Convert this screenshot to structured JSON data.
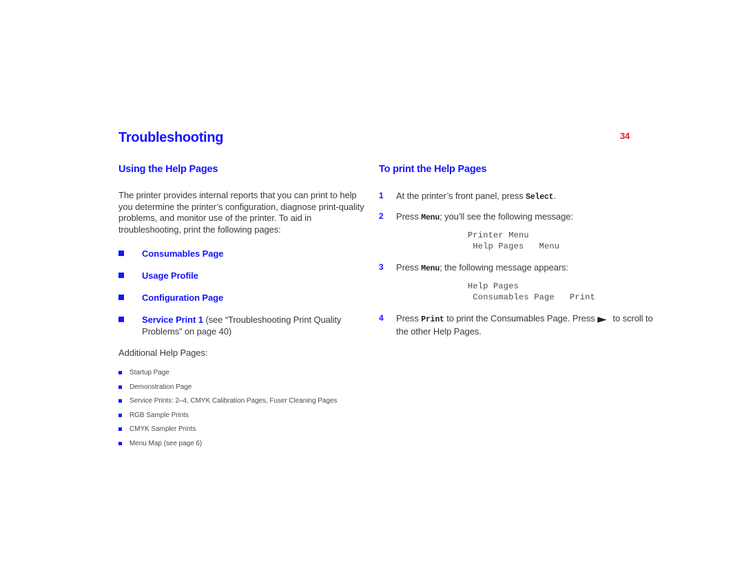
{
  "page": {
    "number": "34",
    "chapter_title": "Troubleshooting",
    "accent_blue": "#1414FF",
    "accent_red": "#ED1C24",
    "body_color": "#3A3A3C"
  },
  "left_column": {
    "heading": "Using the Help Pages",
    "intro_paragraph": "The printer provides internal reports that you can print to help you determine the printer’s configuration, diagnose print-quality problems, and monitor use of the printer.  To aid in troubleshooting, print the following pages:",
    "bullets": [
      {
        "label": "Consumables Page",
        "note": ""
      },
      {
        "label": "Usage Profile",
        "note": ""
      },
      {
        "label": "Configuration Page",
        "note": ""
      },
      {
        "label": "Service Print 1",
        "note": " (see “Troubleshooting Print Quality Problems” on page 40)"
      }
    ],
    "additional_label": "Additional Help Pages:",
    "additional_items": [
      "Startup Page",
      "Demonstration Page",
      "Service Prints: 2–4, CMYK Calibration Pages, Fuser Cleaning Pages",
      "RGB Sample Prints",
      "CMYK Sampler Prints",
      "Menu Map (see page 6)"
    ]
  },
  "right_column": {
    "heading": "To print the Help Pages",
    "steps": [
      {
        "number": "1",
        "text_before": "At the printer’s front panel, press ",
        "key": "Select",
        "text_after": "."
      },
      {
        "number": "2",
        "text_before": "Press ",
        "key": "Menu",
        "text_after": "; you’ll see the following message:"
      },
      {
        "number": "3",
        "text_before": "Press ",
        "key": "Menu",
        "text_after": "; the following message appears:"
      },
      {
        "number": "4",
        "text_before": "Press ",
        "key": "Print",
        "text_after": " to print the Consumables Page. Press ",
        "arrow": "▶",
        "text_end": " to scroll to the other Help Pages."
      }
    ],
    "lcd_message_1": "Printer Menu\n Help Pages   Menu",
    "lcd_message_2": "Help Pages\n Consumables Page   Print"
  }
}
